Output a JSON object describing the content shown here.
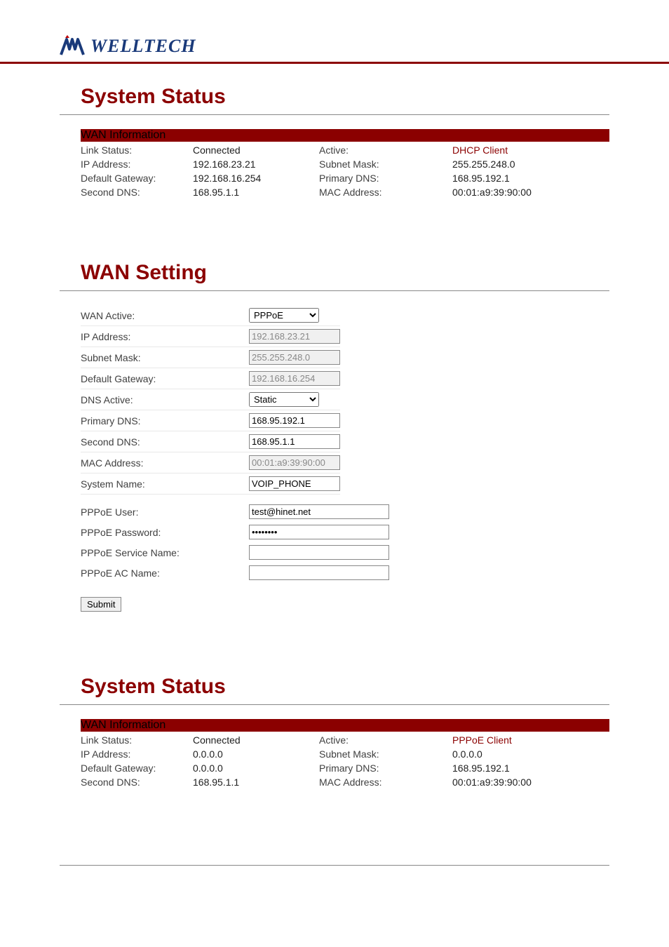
{
  "logo": {
    "text": "WELLTECH"
  },
  "section1": {
    "title": "System Status",
    "header": "WAN Information",
    "rows": {
      "link_status_label": "Link Status:",
      "link_status_value": "Connected",
      "active_label": "Active:",
      "active_value": "DHCP Client",
      "ip_address_label": "IP Address:",
      "ip_address_value": "192.168.23.21",
      "subnet_mask_label": "Subnet Mask:",
      "subnet_mask_value": "255.255.248.0",
      "default_gateway_label": "Default Gateway:",
      "default_gateway_value": "192.168.16.254",
      "primary_dns_label": "Primary DNS:",
      "primary_dns_value": "168.95.192.1",
      "second_dns_label": "Second DNS:",
      "second_dns_value": "168.95.1.1",
      "mac_address_label": "MAC Address:",
      "mac_address_value": "00:01:a9:39:90:00"
    }
  },
  "section2": {
    "title": "WAN Setting",
    "fields": {
      "wan_active_label": "WAN Active:",
      "wan_active_value": "PPPoE",
      "ip_address_label": "IP Address:",
      "ip_address_value": "192.168.23.21",
      "subnet_mask_label": "Subnet Mask:",
      "subnet_mask_value": "255.255.248.0",
      "default_gateway_label": "Default Gateway:",
      "default_gateway_value": "192.168.16.254",
      "dns_active_label": "DNS Active:",
      "dns_active_value": "Static",
      "primary_dns_label": "Primary DNS:",
      "primary_dns_value": "168.95.192.1",
      "second_dns_label": "Second DNS:",
      "second_dns_value": "168.95.1.1",
      "mac_address_label": "MAC Address:",
      "mac_address_value": "00:01:a9:39:90:00",
      "system_name_label": "System Name:",
      "system_name_value": "VOIP_PHONE",
      "pppoe_user_label": "PPPoE User:",
      "pppoe_user_value": "test@hinet.net",
      "pppoe_password_label": "PPPoE Password:",
      "pppoe_password_value": "••••••••",
      "pppoe_service_name_label": "PPPoE Service Name:",
      "pppoe_service_name_value": "",
      "pppoe_ac_name_label": "PPPoE AC Name:",
      "pppoe_ac_name_value": ""
    },
    "submit_label": "Submit"
  },
  "section3": {
    "title": "System Status",
    "header": "WAN Information",
    "rows": {
      "link_status_label": "Link Status:",
      "link_status_value": "Connected",
      "active_label": "Active:",
      "active_value": "PPPoE Client",
      "ip_address_label": "IP Address:",
      "ip_address_value": "0.0.0.0",
      "subnet_mask_label": "Subnet Mask:",
      "subnet_mask_value": "0.0.0.0",
      "default_gateway_label": "Default Gateway:",
      "default_gateway_value": "0.0.0.0",
      "primary_dns_label": "Primary DNS:",
      "primary_dns_value": "168.95.192.1",
      "second_dns_label": "Second DNS:",
      "second_dns_value": "168.95.1.1",
      "mac_address_label": "MAC Address:",
      "mac_address_value": "00:01:a9:39:90:00"
    }
  }
}
